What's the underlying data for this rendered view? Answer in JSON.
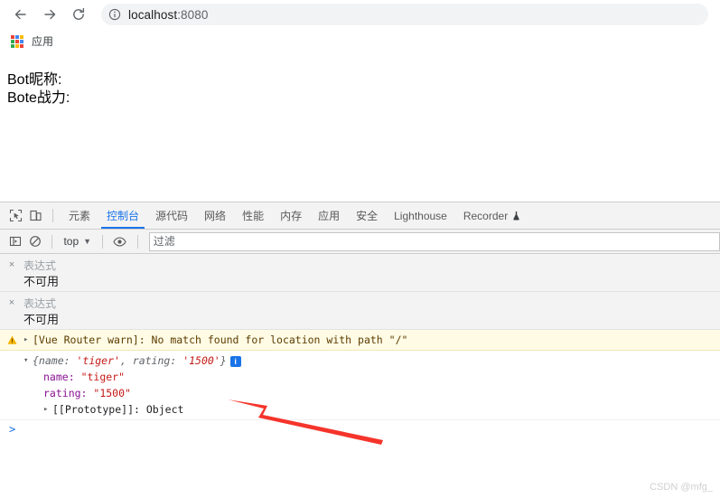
{
  "browser": {
    "back_label": "Back",
    "forward_label": "Forward",
    "reload_label": "Reload",
    "url_main": "localhost",
    "url_port": ":8080",
    "site_info_label": "View site information",
    "bookmarks": {
      "apps_label": "应用",
      "apps_colors": [
        "#ea4335",
        "#4285f4",
        "#fbbc05",
        "#34a853",
        "#ea4335",
        "#4285f4",
        "#34a853",
        "#fbbc05",
        "#ea4335"
      ]
    }
  },
  "page": {
    "lines": [
      "Bot昵称:",
      "Bote战力:"
    ]
  },
  "devtools": {
    "inspect_label": "Inspect element",
    "device_label": "Toggle device toolbar",
    "tabs": [
      {
        "label": "元素",
        "active": false
      },
      {
        "label": "控制台",
        "active": true
      },
      {
        "label": "源代码",
        "active": false
      },
      {
        "label": "网络",
        "active": false
      },
      {
        "label": "性能",
        "active": false
      },
      {
        "label": "内存",
        "active": false
      },
      {
        "label": "应用",
        "active": false
      },
      {
        "label": "安全",
        "active": false
      },
      {
        "label": "Lighthouse",
        "active": false
      },
      {
        "label": "Recorder",
        "active": false,
        "icon": "flask-icon"
      }
    ],
    "console_toolbar": {
      "sidebar_label": "Show console sidebar",
      "clear_label": "Clear console",
      "context": "top",
      "context_caret": "▼",
      "eye_label": "Create live expression",
      "filter_placeholder": "过滤",
      "filter_value": ""
    },
    "live_expressions": [
      {
        "placeholder": "表达式",
        "value": "不可用",
        "close_label": "×"
      },
      {
        "placeholder": "表达式",
        "value": "不可用",
        "close_label": "×"
      }
    ],
    "messages": {
      "warning": {
        "icon": "warning-triangle-icon",
        "disclosure": "▸",
        "text": "[Vue Router warn]: No match found for location with path \"/\""
      },
      "object_log": {
        "disclosure": "▾",
        "preview_open": "{name: ",
        "preview_name_value": "'tiger'",
        "preview_mid": ", rating: ",
        "preview_rating_value": "'1500'",
        "preview_close": "}",
        "info_badge": "i",
        "rows": [
          {
            "key": "name:",
            "value": "\"tiger\"",
            "type": "string"
          },
          {
            "key": "rating:",
            "value": "\"1500\"",
            "type": "string"
          },
          {
            "key": "[[Prototype]]:",
            "value": "Object",
            "type": "proto",
            "disclosure": "▸"
          }
        ]
      }
    },
    "prompt": ">"
  },
  "annotation": {
    "arrow_color": "#f5342b",
    "arrow_label": "red-pointer-arrow"
  },
  "watermark": "CSDN @mfg_"
}
